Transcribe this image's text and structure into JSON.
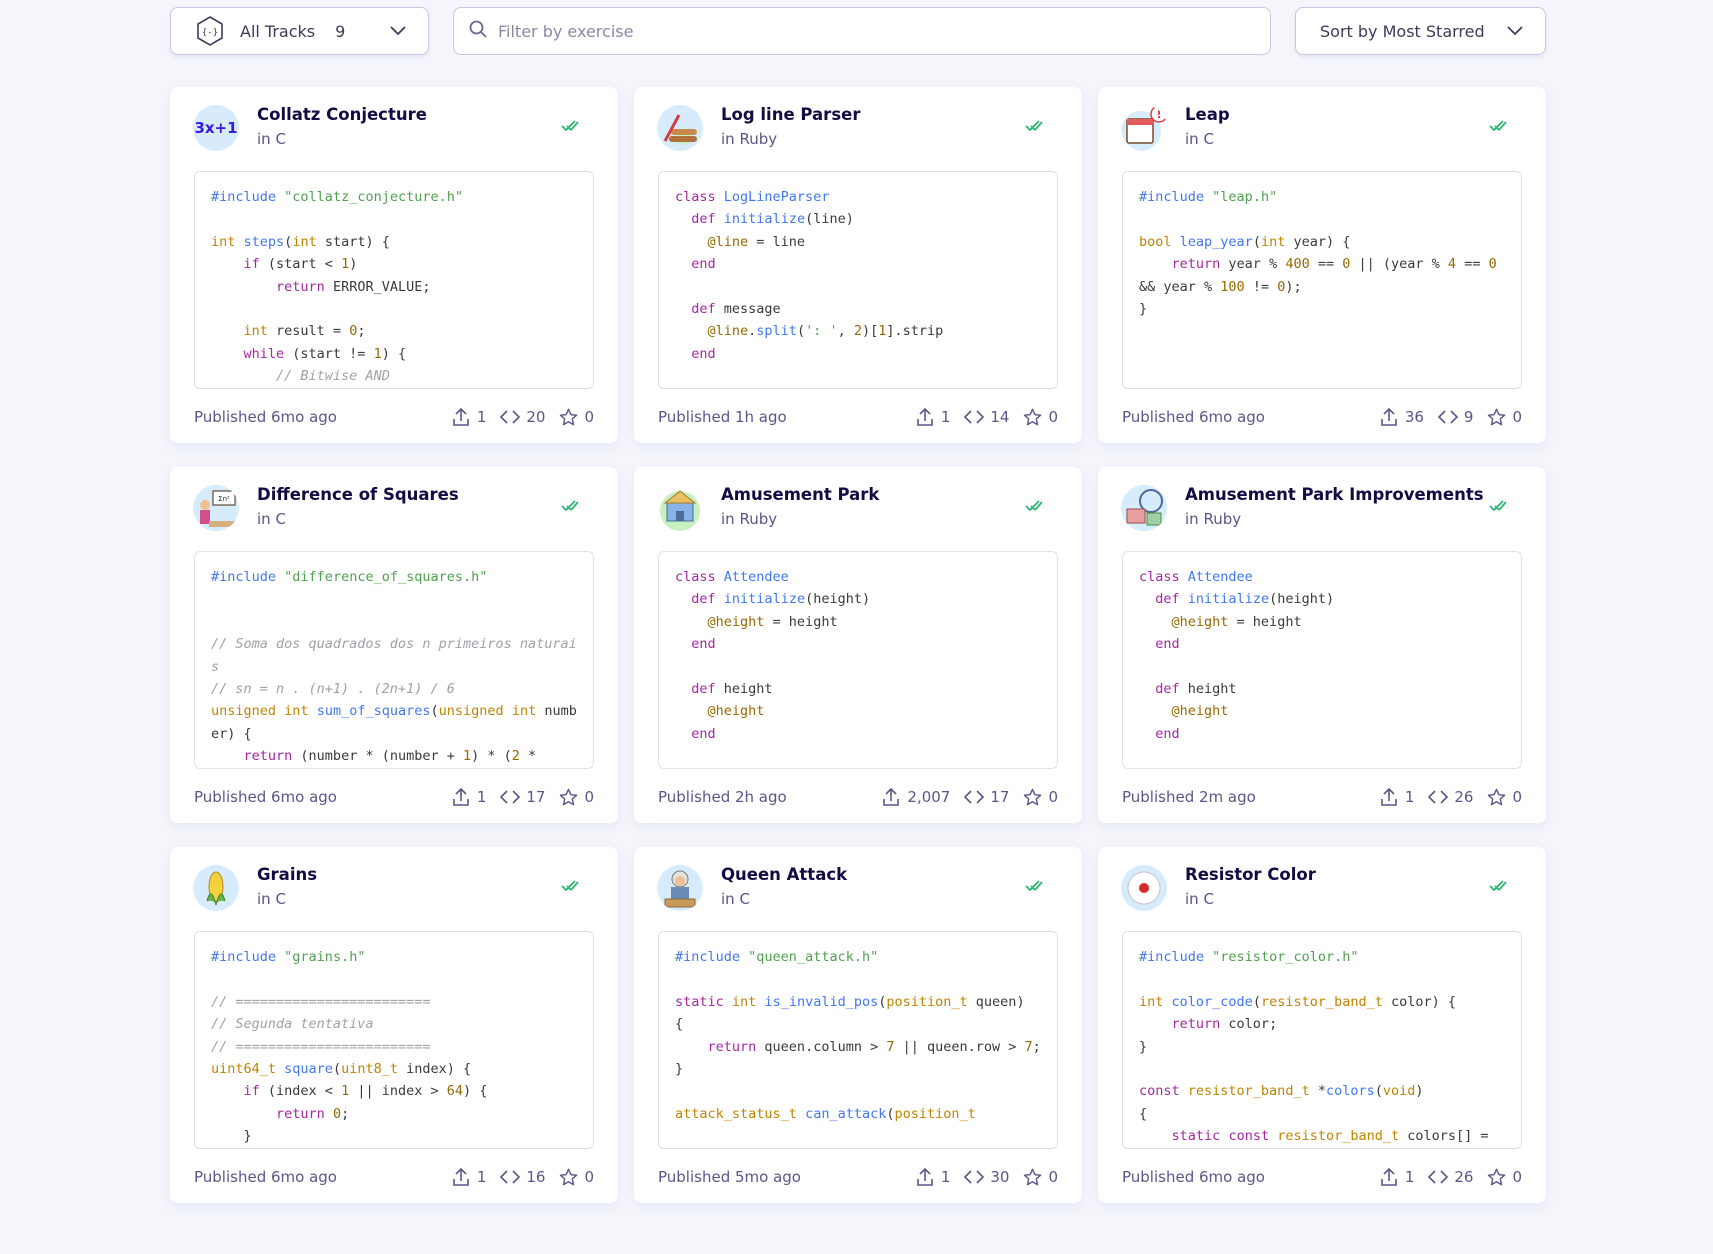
{
  "toolbar": {
    "track_label": "All Tracks",
    "track_count": "9",
    "filter_placeholder": "Filter by exercise",
    "sort_label": "Sort by Most Starred"
  },
  "colors": {
    "check": "#2bb673",
    "border": "#c9c6e4",
    "text": "#130b43",
    "muted": "#5c5589"
  },
  "cards": [
    {
      "title": "Collatz Conjecture",
      "track": "in C",
      "icon": "collatz-3x1-icon",
      "published": "Published 6mo ago",
      "iterations": "1",
      "loc": "20",
      "stars": "0",
      "code": "#include \"collatz_conjecture.h\"\n\nint steps(int start) {\n    if (start < 1)\n        return ERROR_VALUE;\n\n    int result = 0;\n    while (start != 1) {\n        // Bitwise AND"
    },
    {
      "title": "Log line Parser",
      "track": "in Ruby",
      "icon": "log-line-parser-icon",
      "published": "Published 1h ago",
      "iterations": "1",
      "loc": "14",
      "stars": "0",
      "code": "class LogLineParser\n  def initialize(line)\n    @line = line\n  end\n\n  def message\n    @line.split(': ', 2)[1].strip\n  end"
    },
    {
      "title": "Leap",
      "track": "in C",
      "icon": "leap-calendar-icon",
      "published": "Published 6mo ago",
      "iterations": "36",
      "loc": "9",
      "stars": "0",
      "code": "#include \"leap.h\"\n\nbool leap_year(int year) {\n    return year % 400 == 0 || (year % 4 == 0 && year % 100 != 0);\n}"
    },
    {
      "title": "Difference of Squares",
      "track": "in C",
      "icon": "difference-of-squares-icon",
      "published": "Published 6mo ago",
      "iterations": "1",
      "loc": "17",
      "stars": "0",
      "code": "#include \"difference_of_squares.h\"\n\n\n// Soma dos quadrados dos n primeiros naturais\n// sn = n . (n+1) . (2n+1) / 6\nunsigned int sum_of_squares(unsigned int number) {\n    return (number * (number + 1) * (2 *"
    },
    {
      "title": "Amusement Park",
      "track": "in Ruby",
      "icon": "amusement-park-icon",
      "published": "Published 2h ago",
      "iterations": "2,007",
      "loc": "17",
      "stars": "0",
      "code": "class Attendee\n  def initialize(height)\n    @height = height\n  end\n\n  def height\n    @height\n  end"
    },
    {
      "title": "Amusement Park Improvements",
      "track": "in Ruby",
      "icon": "amusement-park-improvements-icon",
      "published": "Published 2m ago",
      "iterations": "1",
      "loc": "26",
      "stars": "0",
      "code": "class Attendee\n  def initialize(height)\n    @height = height\n  end\n\n  def height\n    @height\n  end"
    },
    {
      "title": "Grains",
      "track": "in C",
      "icon": "grains-corn-icon",
      "published": "Published 6mo ago",
      "iterations": "1",
      "loc": "16",
      "stars": "0",
      "code": "#include \"grains.h\"\n\n// ========================\n// Segunda tentativa\n// ========================\nuint64_t square(uint8_t index) {\n    if (index < 1 || index > 64) {\n        return 0;\n    }"
    },
    {
      "title": "Queen Attack",
      "track": "in C",
      "icon": "queen-attack-icon",
      "published": "Published 5mo ago",
      "iterations": "1",
      "loc": "30",
      "stars": "0",
      "code": "#include \"queen_attack.h\"\n\nstatic int is_invalid_pos(position_t queen)\n{\n    return queen.column > 7 || queen.row > 7;\n}\n\nattack_status_t can_attack(position_t"
    },
    {
      "title": "Resistor Color",
      "track": "in C",
      "icon": "resistor-color-icon",
      "published": "Published 6mo ago",
      "iterations": "1",
      "loc": "26",
      "stars": "0",
      "code": "#include \"resistor_color.h\"\n\nint color_code(resistor_band_t color) {\n    return color;\n}\n\nconst resistor_band_t *colors(void)\n{\n    static const resistor_band_t colors[] ="
    }
  ]
}
